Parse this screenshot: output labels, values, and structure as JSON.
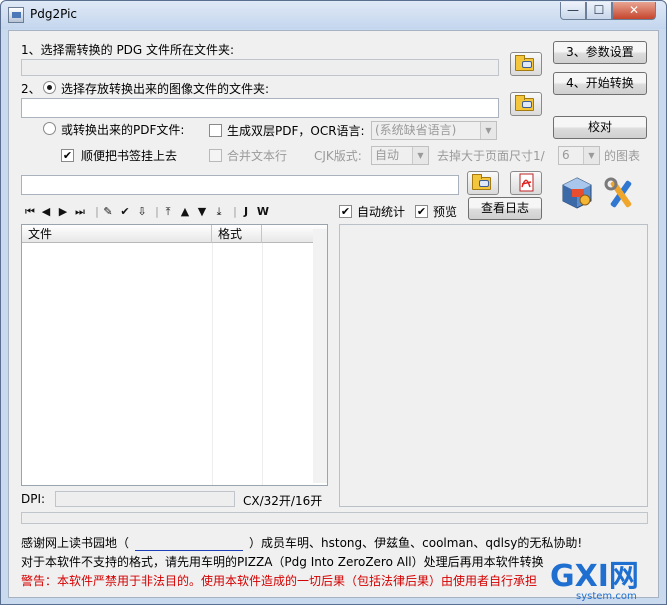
{
  "window": {
    "title": "Pdg2Pic"
  },
  "source": {
    "label": "1、选择需转换的 PDG 文件所在文件夹:",
    "path": ""
  },
  "output": {
    "index": "2、",
    "label": "选择存放转换出来的图像文件的文件夹:",
    "path": ""
  },
  "pdf": {
    "radio_label": "或转换出来的PDF文件:",
    "dual_layer_label": "生成双层PDF，OCR语言:",
    "ocr_language": "(系统缺省语言)",
    "bookmark_label": "顺便把书签挂上去",
    "merge_lines_label": "合并文本行",
    "cjk_label": "CJK版式:",
    "cjk_value": "自动",
    "remove_prefix": "去掉大于页面尺寸1/",
    "remove_value": "6",
    "remove_suffix": "的图表",
    "path": ""
  },
  "buttons": {
    "settings": "3、参数设置",
    "start": "4、开始转换",
    "verify": "校对",
    "view_log": "查看日志"
  },
  "checks": {
    "auto_stats": "自动统计",
    "preview": "预览"
  },
  "list": {
    "columns": [
      "文件",
      "格式"
    ]
  },
  "toolbar": {
    "first": "⏮",
    "prev": "◀",
    "next": "▶",
    "last": "⏭",
    "j": "J",
    "w": "W"
  },
  "status": {
    "dpi_label": "DPI:",
    "format": "CX/32开/16开"
  },
  "footer": {
    "thanks_prefix": "感谢网上读书园地（",
    "thanks_suffix": "）成员车明、hstong、伊兹鱼、coolman、qdlsy的无私协助!",
    "note": "对于本软件不支持的格式，请先用车明的PIZZA（Pdg Into ZeroZero All）处理后再用本软件转换",
    "warning": "警告：本软件严禁用于非法目的。使用本软件造成的一切后果（包括法律后果）由使用者自行承担"
  },
  "watermark": {
    "brand": "GXI网",
    "site": "system.com"
  },
  "colors": {
    "titlebar": "#c4d6ee",
    "warning": "#d40000",
    "link_underline": "#1c3fb8",
    "watermark_blue": "#1f6fd1"
  }
}
